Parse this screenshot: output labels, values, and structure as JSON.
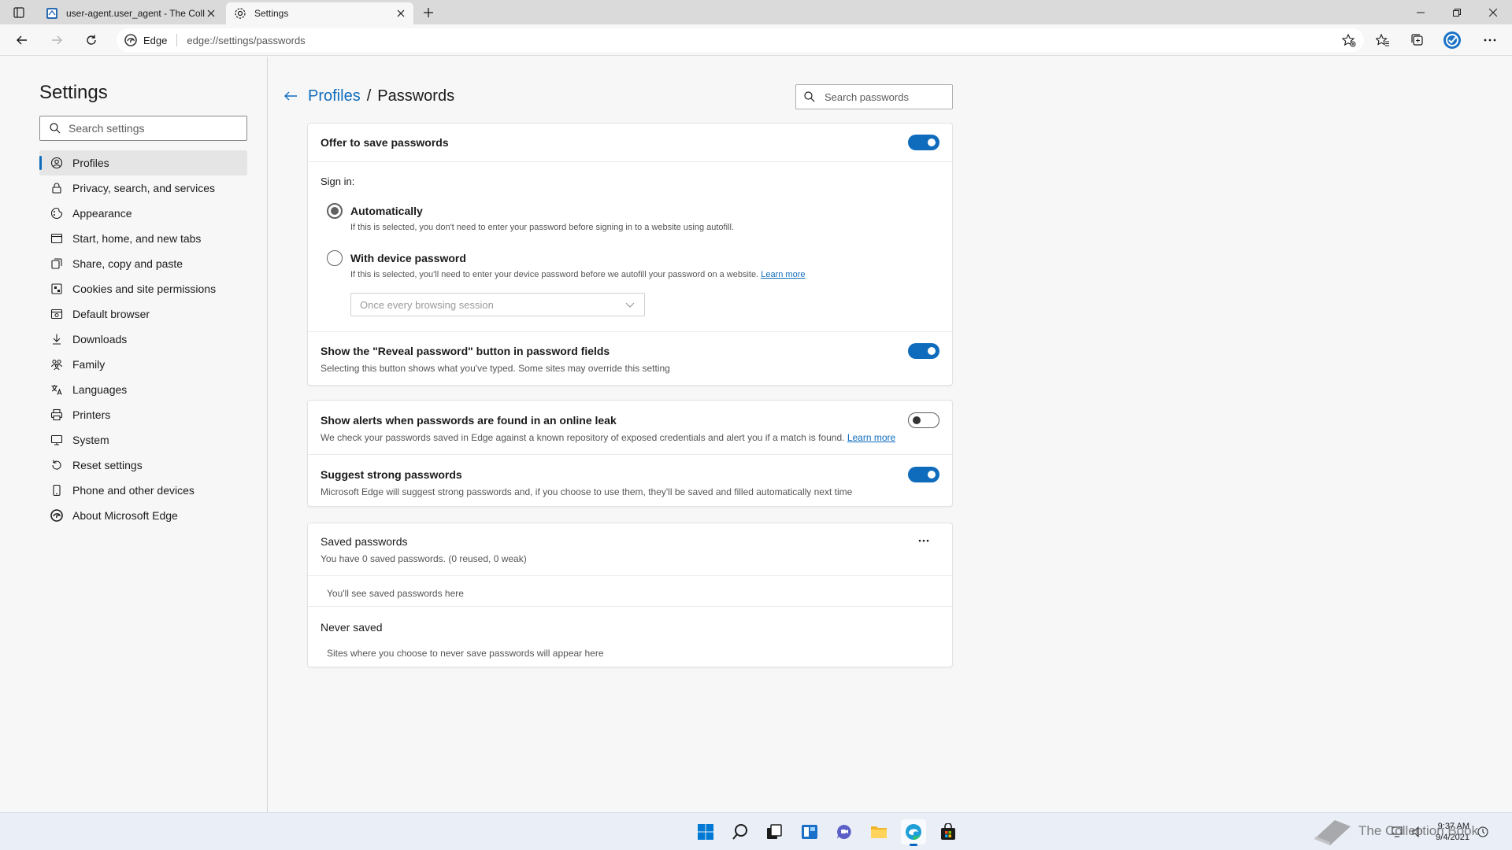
{
  "browser": {
    "tabs": [
      {
        "title": "user-agent.user_agent - The Coll",
        "icon": "document-favicon-icon"
      },
      {
        "title": "Settings",
        "icon": "gear-icon"
      }
    ],
    "address": {
      "site_label": "Edge",
      "url": "edge://settings/passwords"
    }
  },
  "sidebar": {
    "title": "Settings",
    "search_placeholder": "Search settings",
    "items": [
      {
        "label": "Profiles",
        "icon": "profile-icon"
      },
      {
        "label": "Privacy, search, and services",
        "icon": "lock-icon"
      },
      {
        "label": "Appearance",
        "icon": "appearance-icon"
      },
      {
        "label": "Start, home, and new tabs",
        "icon": "home-tabs-icon"
      },
      {
        "label": "Share, copy and paste",
        "icon": "share-icon"
      },
      {
        "label": "Cookies and site permissions",
        "icon": "cookies-icon"
      },
      {
        "label": "Default browser",
        "icon": "browser-icon"
      },
      {
        "label": "Downloads",
        "icon": "download-icon"
      },
      {
        "label": "Family",
        "icon": "family-icon"
      },
      {
        "label": "Languages",
        "icon": "languages-icon"
      },
      {
        "label": "Printers",
        "icon": "printer-icon"
      },
      {
        "label": "System",
        "icon": "system-icon"
      },
      {
        "label": "Reset settings",
        "icon": "reset-icon"
      },
      {
        "label": "Phone and other devices",
        "icon": "phone-icon"
      },
      {
        "label": "About Microsoft Edge",
        "icon": "edge-logo-icon"
      }
    ]
  },
  "main": {
    "breadcrumb": {
      "parent": "Profiles",
      "separator": "/",
      "current": "Passwords"
    },
    "search_placeholder": "Search passwords",
    "offer_save": {
      "title": "Offer to save passwords",
      "enabled": true
    },
    "sign_in": {
      "label": "Sign in:",
      "automatically": {
        "label": "Automatically",
        "desc": "If this is selected, you don't need to enter your password before signing in to a website using autofill.",
        "checked": true
      },
      "device_password": {
        "label": "With device password",
        "desc": "If this is selected, you'll need to enter your device password before we autofill your password on a website.",
        "learn_more": "Learn more",
        "checked": false
      },
      "frequency_select": "Once every browsing session"
    },
    "reveal": {
      "title": "Show the \"Reveal password\" button in password fields",
      "desc": "Selecting this button shows what you've typed. Some sites may override this setting",
      "enabled": true
    },
    "leak_alerts": {
      "title": "Show alerts when passwords are found in an online leak",
      "desc": "We check your passwords saved in Edge against a known repository of exposed credentials and alert you if a match is found.",
      "learn_more": "Learn more",
      "enabled": false
    },
    "suggest": {
      "title": "Suggest strong passwords",
      "desc": "Microsoft Edge will suggest strong passwords and, if you choose to use them, they'll be saved and filled automatically next time",
      "enabled": true
    },
    "saved": {
      "title": "Saved passwords",
      "summary": "You have 0 saved passwords. (0 reused, 0 weak)",
      "empty": "You'll see saved passwords here"
    },
    "never_saved": {
      "title": "Never saved",
      "empty": "Sites where you choose to never save passwords will appear here"
    }
  },
  "taskbar": {
    "apps": [
      "start-icon",
      "search-icon",
      "task-view-icon",
      "widgets-icon",
      "chat-icon",
      "file-explorer-icon",
      "edge-icon",
      "store-icon"
    ],
    "time": "9:37 AM",
    "date": "9/4/2021",
    "watermark": "The Collection Book"
  },
  "colors": {
    "accent": "#0f6cbd",
    "background": "#f7f7f7",
    "card": "#ffffff"
  }
}
